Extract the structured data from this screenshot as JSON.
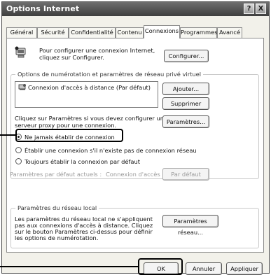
{
  "window": {
    "title": "Options Internet",
    "help_glyph": "?",
    "close_glyph": "X"
  },
  "tabs": [
    {
      "label": "Général"
    },
    {
      "label": "Sécurité"
    },
    {
      "label": "Confidentialité"
    },
    {
      "label": "Contenu"
    },
    {
      "label": "Connexions",
      "active": true
    },
    {
      "label": "Programmes"
    },
    {
      "label": "Avancé"
    }
  ],
  "setup": {
    "text_line1": "Pour configurer une connexion Internet,",
    "text_line2": "cliquez sur Configurer.",
    "button": "Configurer..."
  },
  "dialup": {
    "group_title": "Options de numérotation et paramètres de réseau privé virtuel",
    "list_item": "Connexion d'accès à distance (Par défaut)",
    "add_button": "Ajouter...",
    "remove_button": "Supprimer",
    "proxy_line1": "Cliquez sur Paramètres si vous devez configurer un",
    "proxy_line2": "serveur proxy pour une connexion.",
    "settings_button": "Paramètres...",
    "radio_never": "Ne jamais établir de connexion",
    "radio_when_none": "Établir une connexion s'il n'existe pas de connexion réseau",
    "radio_always": "Toujours établir la connexion par défaut",
    "current_default_label": "Paramètres par défaut actuels :",
    "current_default_value": "Connexion d'accès",
    "set_default_button": "Par défaut"
  },
  "lan": {
    "group_title": "Paramètres du réseau local",
    "text_line1": "Les paramètres du réseau local ne s'appliquent",
    "text_line2": "pas aux connexions d'accès à distance. Cliquez",
    "text_line3": "sur le bouton Paramètres ci-dessus pour définir",
    "text_line4": "les options de numérotation.",
    "button": "Paramètres réseau..."
  },
  "footer": {
    "ok": "OK",
    "cancel": "Annuler",
    "apply": "Appliquer"
  }
}
